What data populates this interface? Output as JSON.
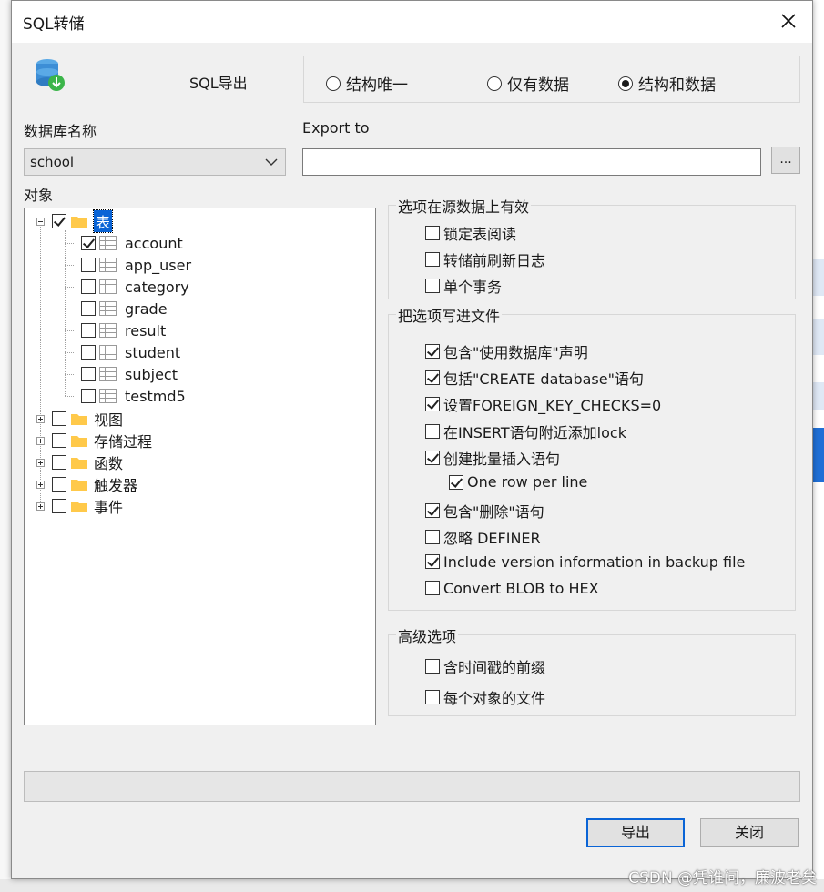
{
  "dialog": {
    "title": "SQL转储",
    "sql_export_label": "SQL导出",
    "export_mode": {
      "options": [
        "结构唯一",
        "仅有数据",
        "结构和数据"
      ],
      "selected": "结构和数据"
    },
    "database_label": "数据库名称",
    "database_value": "school",
    "export_to_label": "Export to",
    "export_to_value": "",
    "browse_label": "...",
    "objects_label": "对象",
    "tree": {
      "tables_label": "表",
      "tables": [
        {
          "name": "account",
          "checked": true
        },
        {
          "name": "app_user",
          "checked": false
        },
        {
          "name": "category",
          "checked": false
        },
        {
          "name": "grade",
          "checked": false
        },
        {
          "name": "result",
          "checked": false
        },
        {
          "name": "student",
          "checked": false
        },
        {
          "name": "subject",
          "checked": false
        },
        {
          "name": "testmd5",
          "checked": false
        }
      ],
      "folders": [
        "视图",
        "存储过程",
        "函数",
        "触发器",
        "事件"
      ]
    },
    "source_options": {
      "title": "选项在源数据上有效",
      "items": [
        {
          "label": "锁定表阅读",
          "checked": false
        },
        {
          "label": "转储前刷新日志",
          "checked": false
        },
        {
          "label": "单个事务",
          "checked": false
        }
      ]
    },
    "write_options": {
      "title": "把选项写进文件",
      "items": [
        {
          "label": "包含\"使用数据库\"声明",
          "checked": true
        },
        {
          "label": "包括\"CREATE database\"语句",
          "checked": true
        },
        {
          "label": "设置FOREIGN_KEY_CHECKS=0",
          "checked": true
        },
        {
          "label": "在INSERT语句附近添加lock",
          "checked": false
        },
        {
          "label": "创建批量插入语句",
          "checked": true
        },
        {
          "label": "One row per line",
          "checked": true
        },
        {
          "label": "包含\"删除\"语句",
          "checked": true
        },
        {
          "label": "忽略 DEFINER",
          "checked": false
        },
        {
          "label": "Include version information in backup file",
          "checked": true
        },
        {
          "label": "Convert BLOB to HEX",
          "checked": false
        }
      ]
    },
    "advanced_options": {
      "title": "高级选项",
      "items": [
        {
          "label": "含时间戳的前缀",
          "checked": false
        },
        {
          "label": "每个对象的文件",
          "checked": false
        }
      ]
    },
    "export_button": "导出",
    "close_button": "关闭"
  },
  "watermark": "CSDN @凭谁问，廉波老矣",
  "colors": {
    "selection": "#0a64d6",
    "dialog_bg": "#f0f0f0",
    "folder": "#ffc94a"
  }
}
